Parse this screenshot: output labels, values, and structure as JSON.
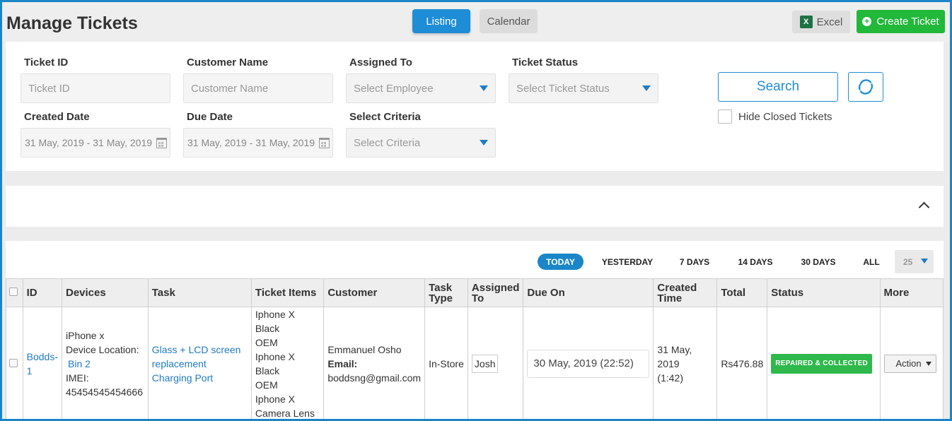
{
  "header": {
    "title": "Manage Tickets",
    "listing_label": "Listing",
    "calendar_label": "Calendar",
    "excel_label": "Excel",
    "excel_icon_glyph": "X",
    "create_label": "Create Ticket",
    "accent_color": "#1f8dd6",
    "create_color": "#22b83a"
  },
  "filters": {
    "ticket_id": {
      "label": "Ticket ID",
      "placeholder": "Ticket ID"
    },
    "customer_name": {
      "label": "Customer Name",
      "placeholder": "Customer Name"
    },
    "assigned_to": {
      "label": "Assigned To",
      "placeholder": "Select Employee"
    },
    "ticket_status": {
      "label": "Ticket Status",
      "placeholder": "Select Ticket Status"
    },
    "created_date": {
      "label": "Created Date",
      "value": "31 May, 2019 - 31 May, 2019"
    },
    "due_date": {
      "label": "Due Date",
      "value": "31 May, 2019 - 31 May, 2019"
    },
    "select_criteria": {
      "label": "Select Criteria",
      "placeholder": "Select Criteria"
    },
    "search_label": "Search",
    "hide_closed_label": "Hide Closed Tickets"
  },
  "ranges": [
    "TODAY",
    "YESTERDAY",
    "7 DAYS",
    "14 DAYS",
    "30 DAYS",
    "ALL"
  ],
  "per_page": "25",
  "table": {
    "columns": {
      "id": "ID",
      "devices": "Devices",
      "task": "Task",
      "ticket_items": "Ticket Items",
      "customer": "Customer",
      "task_type_1": "Task",
      "task_type_2": "Type",
      "assigned_1": "Assigned",
      "assigned_2": "To",
      "due_on": "Due On",
      "created_1": "Created",
      "created_2": "Time",
      "total": "Total",
      "status": "Status",
      "more": "More"
    },
    "row": {
      "id_1": "Bodds-",
      "id_2": "1",
      "device_name": "iPhone x",
      "device_location_label": "Device Location:",
      "bin": "Bin 2",
      "imei_label": "IMEI:",
      "imei": "45454545454666",
      "task_1": "Glass + LCD screen",
      "task_2": "replacement",
      "task_3": "Charging Port",
      "item_1a": "Iphone X Black",
      "item_1b": "OEM",
      "item_2a": "Iphone X Black",
      "item_2b": "OEM",
      "item_3a": "Iphone X",
      "item_3b": "Camera Lens",
      "customer_name": "Emmanuel Osho",
      "email_label": "Email:",
      "email": "boddsng@gmail.com",
      "task_type": "In-Store",
      "assigned_to": "Josh",
      "due_on": "30 May, 2019 (22:52)",
      "created_1": "31 May, 2019",
      "created_2": "(1:42)",
      "total": "Rs476.88",
      "status": "REPAIRED & COLLECTED",
      "action_label": "Action"
    }
  }
}
